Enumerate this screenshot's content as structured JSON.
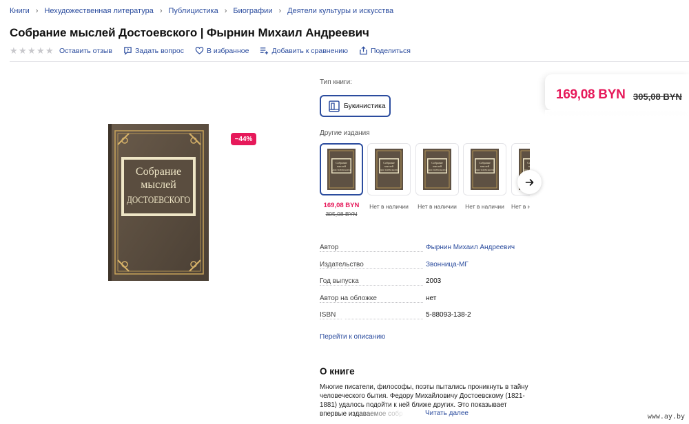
{
  "breadcrumb": [
    "Книги",
    "Нехудожественная литература",
    "Публицистика",
    "Биографии",
    "Деятели культуры и искусства"
  ],
  "title": "Собрание мыслей Достоевского | Фырнин Михаил Андреевич",
  "rating": {
    "stars_filled": 0,
    "stars_total": 5
  },
  "actions": {
    "review": "Оставить отзыв",
    "ask": "Задать вопрос",
    "favorite": "В избранное",
    "compare": "Добавить к сравнению",
    "share": "Поделиться"
  },
  "cover": {
    "lines": [
      "Собрание",
      "мыслей",
      "ДОСТОЕВСКОГО"
    ],
    "color": "#5e5143",
    "gold": "#c9a45a"
  },
  "discount": "−44%",
  "book_type": {
    "label": "Тип книги:",
    "option": "Букинистика"
  },
  "editions": {
    "label": "Другие издания",
    "items": [
      {
        "status": "",
        "price": "169,08 BYN",
        "old_price": "305,08 BYN",
        "active": true
      },
      {
        "status": "Нет в наличии"
      },
      {
        "status": "Нет в наличии"
      },
      {
        "status": "Нет в наличии"
      },
      {
        "status": "Нет в наличии"
      }
    ]
  },
  "specs": [
    {
      "key": "Автор",
      "value": "Фырнин Михаил Андреевич",
      "link": true
    },
    {
      "key": "Издательство",
      "value": "Звонница-МГ",
      "link": true
    },
    {
      "key": "Год выпуска",
      "value": "2003",
      "link": false
    },
    {
      "key": "Автор на обложке",
      "value": "нет",
      "link": false
    },
    {
      "key": "ISBN",
      "value": "5-88093-138-2",
      "link": false,
      "info": true
    }
  ],
  "goto_description": "Перейти к описанию",
  "about": {
    "title": "О книге",
    "text": "Многие писатели, философы, поэты пытались проникнуть в тайну человеческого бытия. Федору Михайловичу Достоевскому (1821-1881) удалось подойти к ней ближе других. Это показывает впервые издаваемое собр",
    "read_more": "Читать далее"
  },
  "price": {
    "current": "169,08 BYN",
    "old": "305,08 BYN"
  },
  "watermark": "www.ay.by",
  "colors": {
    "accent": "#2b4c9e",
    "price": "#e6195a"
  }
}
